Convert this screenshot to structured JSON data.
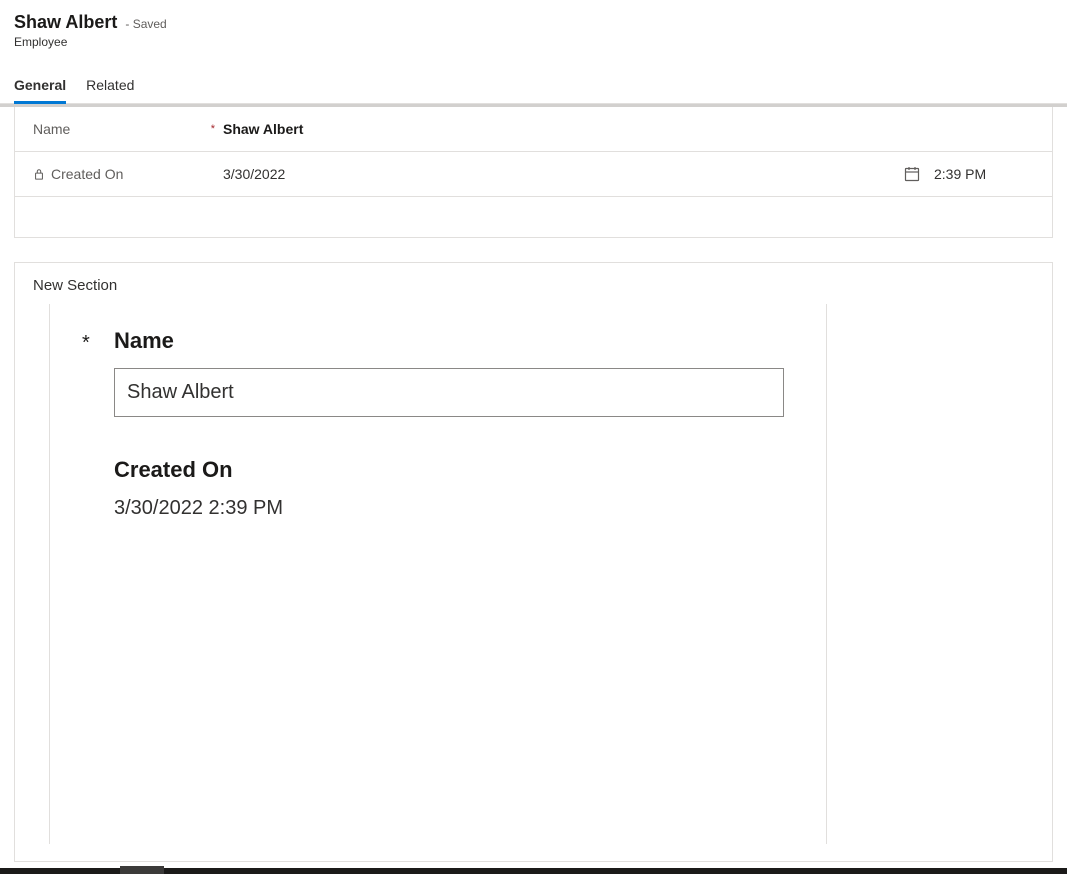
{
  "header": {
    "title": "Shaw Albert",
    "status": "- Saved",
    "subtitle": "Employee"
  },
  "tabs": {
    "general": "General",
    "related": "Related"
  },
  "formSection": {
    "nameLabel": "Name",
    "nameValue": "Shaw Albert",
    "createdOnLabel": "Created On",
    "createdOnDate": "3/30/2022",
    "createdOnTime": "2:39 PM"
  },
  "newSection": {
    "title": "New Section",
    "nameLabel": "Name",
    "nameValue": "Shaw Albert",
    "createdOnLabel": "Created On",
    "createdOnValue": "3/30/2022 2:39 PM"
  }
}
